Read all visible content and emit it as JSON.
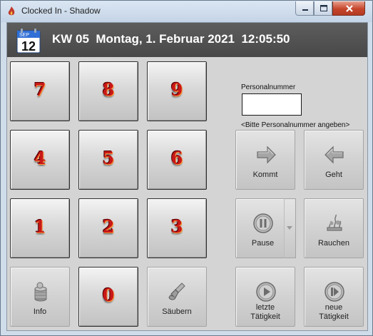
{
  "window": {
    "title": "Clocked In - Shadow",
    "controls": {
      "minimize": "minimize",
      "maximize": "maximize",
      "close": "close"
    }
  },
  "header": {
    "calendar": {
      "month": "SEP",
      "day": "12"
    },
    "text": "KW 05  Montag, 1. Februar 2021  12:05:50"
  },
  "keypad": {
    "digits": [
      "7",
      "8",
      "9",
      "4",
      "5",
      "6",
      "1",
      "2",
      "3",
      "0"
    ],
    "info_label": "Info",
    "clear_label": "Säubern"
  },
  "personnel": {
    "label": "Personalnummer",
    "value": "",
    "hint": "<Bitte Personalnummer angeben>"
  },
  "actions": {
    "kommt": "Kommt",
    "geht": "Geht",
    "pause": "Pause",
    "rauchen": "Rauchen",
    "letzte_line1": "letzte",
    "letzte_line2": "Tätigkeit",
    "neue_line1": "neue",
    "neue_line2": "Tätigkeit"
  },
  "colors": {
    "digit": "#c81818",
    "header_bg": "#4a4a4a",
    "panel_bg": "#d4d4d4"
  }
}
